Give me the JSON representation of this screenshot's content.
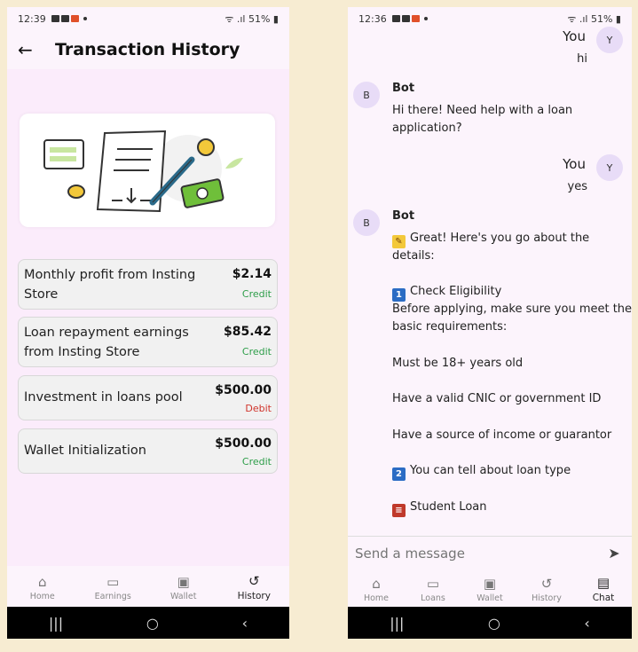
{
  "left": {
    "status": {
      "time": "12:39",
      "right": "51%"
    },
    "title": "Transaction History",
    "transactions": [
      {
        "line1": "Monthly profit from Insting",
        "line2": "Store",
        "amount": "$2.14",
        "type": "Credit"
      },
      {
        "line1": "Loan repayment earnings",
        "line2": "from Insting Store",
        "amount": "$85.42",
        "type": "Credit"
      },
      {
        "line1": "Investment in loans pool",
        "line2": "",
        "amount": "$500.00",
        "type": "Debit"
      },
      {
        "line1": "Wallet Initialization",
        "line2": "",
        "amount": "$500.00",
        "type": "Credit"
      }
    ],
    "nav": [
      {
        "label": "Home",
        "icon": "home-icon"
      },
      {
        "label": "Earnings",
        "icon": "card-icon"
      },
      {
        "label": "Wallet",
        "icon": "wallet-icon"
      },
      {
        "label": "History",
        "icon": "history-icon"
      }
    ]
  },
  "right": {
    "status": {
      "time": "12:36",
      "right": "51%"
    },
    "messages": {
      "you1": {
        "sender": "You",
        "avatar": "Y",
        "text": "hi"
      },
      "bot1": {
        "sender": "Bot",
        "avatar": "B",
        "lines": [
          "Hi there! Need help with a loan",
          "application?"
        ]
      },
      "you2": {
        "sender": "You",
        "avatar": "Y",
        "text": "yes"
      },
      "bot2": {
        "sender": "Bot",
        "avatar": "B",
        "lines": [
          "Great! Here's you go about the",
          "details:",
          "Check Eligibility",
          "Before applying, make sure you meet the",
          "basic requirements:",
          "Must be 18+ years old",
          "Have a valid CNIC or government ID",
          "Have a source of income or guarantor",
          "You can tell about  loan type",
          "Student Loan"
        ],
        "num1": "1",
        "num2": "2"
      }
    },
    "input_placeholder": "Send a message",
    "nav": [
      {
        "label": "Home",
        "icon": "home-icon"
      },
      {
        "label": "Loans",
        "icon": "card-icon"
      },
      {
        "label": "Wallet",
        "icon": "wallet-icon"
      },
      {
        "label": "History",
        "icon": "history-icon"
      },
      {
        "label": "Chat",
        "icon": "chat-icon"
      }
    ]
  },
  "colors": {
    "credit": "#2e9e4a",
    "debit": "#d0342c",
    "avatar": "#e8dcf7"
  }
}
